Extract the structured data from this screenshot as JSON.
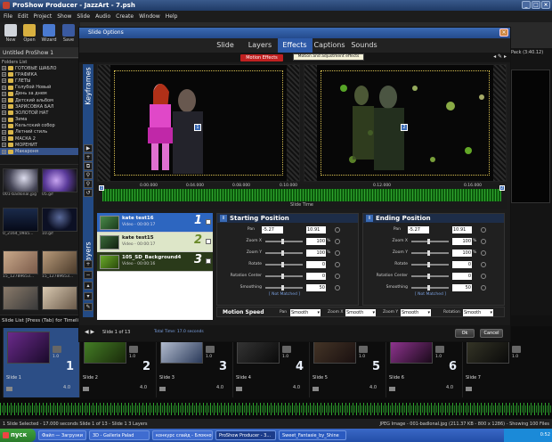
{
  "window": {
    "title": "ProShow Producer - JazzArt - 7.psh"
  },
  "menu": [
    "File",
    "Edit",
    "Project",
    "Show",
    "Slide",
    "Audio",
    "Create",
    "Window",
    "Help"
  ],
  "toolbar": [
    "New",
    "Open",
    "Wizard",
    "Save"
  ],
  "project": {
    "name": "Untitled ProShow 1",
    "folder_header": "Folders List"
  },
  "folders": [
    {
      "label": "ГОТОВЫЕ ШАБЛО",
      "expand": "+"
    },
    {
      "label": "ГРАФИКА",
      "expand": "+"
    },
    {
      "label": "ГЛЕТЫ",
      "expand": "+"
    },
    {
      "label": "Голубой Новый",
      "expand": "+"
    },
    {
      "label": "День за днем",
      "expand": "+"
    },
    {
      "label": "Детский альбом",
      "expand": "+"
    },
    {
      "label": "ЗАРИСОВКА БАЛ",
      "expand": "+"
    },
    {
      "label": "ЗОЛОТОЙ НАТ",
      "expand": "+"
    },
    {
      "label": "Зима",
      "expand": "+"
    },
    {
      "label": "Кельтский собор",
      "expand": "+"
    },
    {
      "label": "Летний стиль",
      "expand": "+"
    },
    {
      "label": "МАСКА 2",
      "expand": "+"
    },
    {
      "label": "МОРЕНИТ",
      "expand": "+"
    },
    {
      "label": "Макароня",
      "expand": "+"
    }
  ],
  "thumbs": [
    {
      "label": "001-badlonal.jpg"
    },
    {
      "label": "05.gif"
    },
    {
      "label": "0_2164_09a5..."
    },
    {
      "label": "10.gif"
    },
    {
      "label": "15_12789653..."
    },
    {
      "label": "15_12789653..."
    }
  ],
  "right_panel": {
    "label": "Pack (3:40.12)"
  },
  "slide_list_header": "Slide List [Press (Tab) for Timeline]",
  "slides": [
    {
      "label": "Slide 1",
      "num": "1",
      "trans": "1.0",
      "dur": "4.0"
    },
    {
      "label": "Slide 2",
      "num": "2",
      "trans": "1.0",
      "dur": "4.0"
    },
    {
      "label": "Slide 3",
      "num": "3",
      "trans": "1.0",
      "dur": "4.0"
    },
    {
      "label": "Slide 4",
      "num": "4",
      "trans": "1.0",
      "dur": "4.0"
    },
    {
      "label": "Slide 5",
      "num": "5",
      "trans": "1.0",
      "dur": "4.0"
    },
    {
      "label": "Slide 6",
      "num": "6",
      "trans": "1.0",
      "dur": "4.0"
    },
    {
      "label": "Slide 7",
      "num": "",
      "trans": "1.0",
      "dur": ""
    }
  ],
  "status": {
    "left": "1 Slide Selected - 17.000 seconds    Slide 1 of 13 - Slide 1    3 Layers",
    "right": "JPEG Image - 001-badlonal.jpg (211.37 KB - 800 x 1286) - Showing 100 Files"
  },
  "taskbar": {
    "start": "пуск",
    "tasks": [
      "Файл — Загрузки",
      "3D - Galleria Palad",
      "конкурс слайд - Блокнот",
      "ProShow Producer - 3..."
    ],
    "tray": "Sweet_Fantasie_by_Shine",
    "clock": "0:52"
  },
  "dialog": {
    "title": "Slide Options",
    "tabs": [
      "Slide",
      "Layers",
      "Effects",
      "Captions",
      "Sounds"
    ],
    "active_tab": "Effects",
    "subtab": "Motion Effects",
    "tooltip": "Motion and adjustment effects",
    "keyframes_label": "Keyframes",
    "layers_label": "Layers",
    "timeline_ticks": [
      "0.00.000",
      "0.04.000",
      "0.08.000",
      "0.10.000",
      "0.12.000",
      "0.16.000"
    ],
    "timeline_label": "Slide Time",
    "layers": [
      {
        "name": "kate test16",
        "sub": "Video - 00:00:17",
        "num": "1"
      },
      {
        "name": "kate test15",
        "sub": "Video - 00:00:17",
        "num": "2"
      },
      {
        "name": "105_SD_Background4",
        "sub": "Video - 00:00:16",
        "num": "3"
      }
    ],
    "start": {
      "title": "Starting Position",
      "pan_x": "-5.27",
      "pan_y": "10.91",
      "zoom_x": "100",
      "zoom_y": "100",
      "rotate": "0",
      "rot_center": "0",
      "smoothing": "50",
      "not_matched": "[ Not Matched ]"
    },
    "end": {
      "title": "Ending Position",
      "pan_x": "-5.27",
      "pan_y": "10.91",
      "zoom_x": "100",
      "zoom_y": "100",
      "rotate": "0",
      "rot_center": "0",
      "smoothing": "50",
      "not_matched": "[ Not Matched ]"
    },
    "labels": {
      "pan": "Pan",
      "zoom_x": "Zoom X",
      "zoom_y": "Zoom Y",
      "rotate": "Rotate",
      "rot_center": "Rotation Center",
      "smoothing": "Smoothing"
    },
    "motion": {
      "title": "Motion Speed",
      "pan": "Smooth",
      "zoom_x": "Smooth",
      "zoom_y": "Smooth",
      "rotation": "Smooth",
      "pan_label": "Pan",
      "zoom_x_label": "Zoom X",
      "zoom_y_label": "Zoom Y",
      "rotation_label": "Rotation"
    },
    "footer": {
      "slide_of": "Slide 1 of 13",
      "total_time": "Total Time: 17.0 seconds",
      "ok": "Ok",
      "cancel": "Cancel"
    }
  },
  "colors": {
    "accent": "#2e5aa8",
    "tab_active": "#2e5aa8",
    "subtab": "#c02020"
  }
}
